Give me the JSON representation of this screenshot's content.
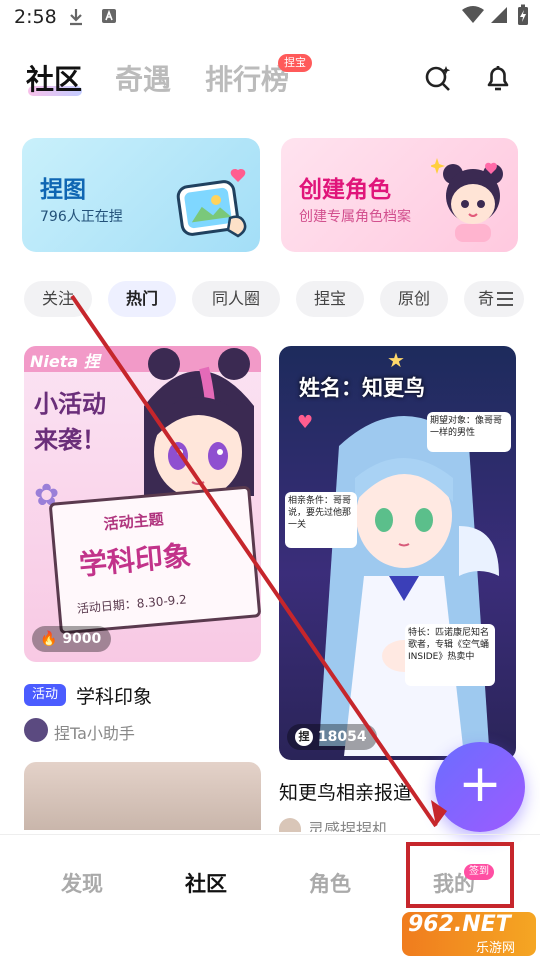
{
  "status": {
    "time": "2:58"
  },
  "top_tabs": [
    {
      "label": "社区",
      "active": true
    },
    {
      "label": "奇遇",
      "active": false
    },
    {
      "label": "排行榜",
      "active": false
    }
  ],
  "top_badge": "捏宝",
  "cards": {
    "nie_tu": {
      "title": "捏图",
      "subtitle": "796人正在捏"
    },
    "create_role": {
      "title": "创建角色",
      "subtitle": "创建专属角色档案"
    }
  },
  "chips": [
    "关注",
    "热门",
    "同人圈",
    "捏宝",
    "原创",
    "奇"
  ],
  "posts": {
    "left": {
      "image_text": {
        "brand": "Nieta 捏",
        "headline1": "小活动",
        "headline2": "来袭！",
        "theme_label": "活动主题",
        "theme": "学科印象",
        "date": "活动日期：8.30-9.2"
      },
      "likes": "9000",
      "tag": "活动",
      "title": "学科印象",
      "author": "捏Ta小助手"
    },
    "right": {
      "image_text": {
        "name": "姓名：知更鸟",
        "bubble1": "期望对象：像哥哥一样的男性",
        "bubble2": "相亲条件：哥哥说，要先过他那一关",
        "bubble3": "特长：匹诺康尼知名歌者，专辑《空气蛹INSIDE》热卖中"
      },
      "likes": "18054",
      "title": "知更鸟相亲报道",
      "author": "灵感捏捏机"
    }
  },
  "bottom_nav": [
    {
      "label": "发现",
      "active": false
    },
    {
      "label": "社区",
      "active": true
    },
    {
      "label": "角色",
      "active": false
    },
    {
      "label": "我的",
      "active": false
    }
  ],
  "nav_badge": "签到",
  "fab": "+",
  "watermark": {
    "site": "962.NET",
    "sub": "乐游网"
  },
  "colors": {
    "accent": "#7a63ff",
    "red": "#c6262c",
    "activity_tag": "#4b5cff"
  }
}
